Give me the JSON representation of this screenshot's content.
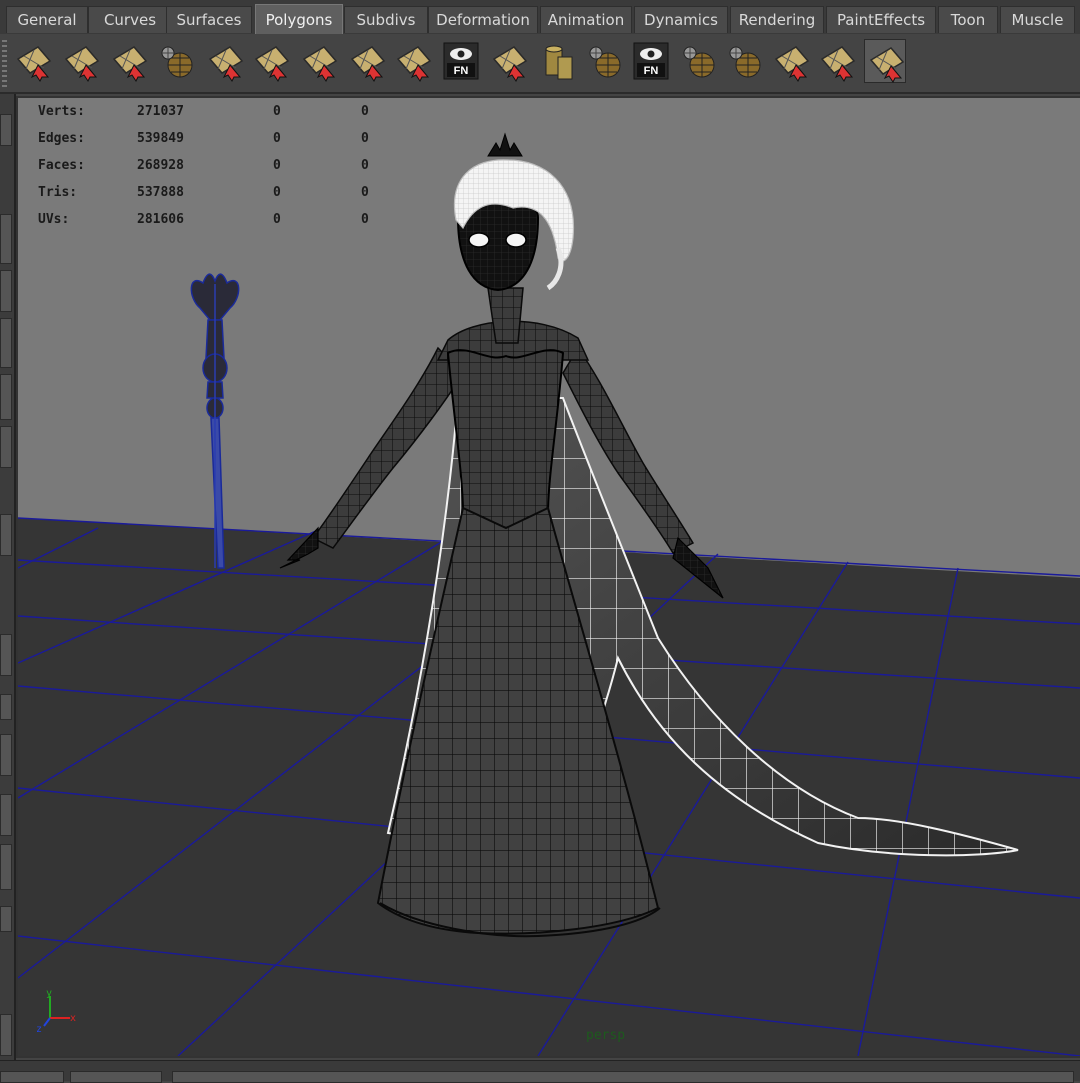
{
  "menu_tabs": [
    {
      "label": "General",
      "active": false
    },
    {
      "label": "Curves",
      "active": false
    },
    {
      "label": "Surfaces",
      "active": false
    },
    {
      "label": "Polygons",
      "active": true
    },
    {
      "label": "Subdivs",
      "active": false
    },
    {
      "label": "Deformation",
      "active": false
    },
    {
      "label": "Animation",
      "active": false
    },
    {
      "label": "Dynamics",
      "active": false
    },
    {
      "label": "Rendering",
      "active": false
    },
    {
      "label": "PaintEffects",
      "active": false
    },
    {
      "label": "Toon",
      "active": false
    },
    {
      "label": "Muscle",
      "active": false
    }
  ],
  "shelf_icons": [
    {
      "icon": "select-face-icon",
      "label": ""
    },
    {
      "icon": "edit-vertex-icon",
      "label": ""
    },
    {
      "icon": "extrude-icon",
      "label": ""
    },
    {
      "icon": "sphere-grid-icon",
      "label": ""
    },
    {
      "icon": "select-face-arrow-icon",
      "label": ""
    },
    {
      "icon": "uv-striped-icon",
      "label": ""
    },
    {
      "icon": "split-polygon-icon",
      "label": ""
    },
    {
      "icon": "planar-map-icon",
      "label": ""
    },
    {
      "icon": "uv-layout-icon",
      "label": ""
    },
    {
      "icon": "eye-fn-icon",
      "label": "FN"
    },
    {
      "icon": "cut-faces-icon",
      "label": ""
    },
    {
      "icon": "cylinder-icon",
      "label": ""
    },
    {
      "icon": "sphere-cube-icon",
      "label": ""
    },
    {
      "icon": "eye-fn-icon",
      "label": "FN"
    },
    {
      "icon": "globe-sphere-icon",
      "label": ""
    },
    {
      "icon": "shield-sphere-icon",
      "label": ""
    },
    {
      "icon": "pin-plane-icon",
      "label": ""
    },
    {
      "icon": "pencil-plane-icon",
      "label": ""
    },
    {
      "icon": "select-face-icon",
      "label": ""
    }
  ],
  "hud": {
    "rows": [
      {
        "label": "Verts:",
        "value": "271037",
        "sel": "0",
        "extra": "0"
      },
      {
        "label": "Edges:",
        "value": "539849",
        "sel": "0",
        "extra": "0"
      },
      {
        "label": "Faces:",
        "value": "268928",
        "sel": "0",
        "extra": "0"
      },
      {
        "label": "Tris:",
        "value": "537888",
        "sel": "0",
        "extra": "0"
      },
      {
        "label": "UVs:",
        "value": "281606",
        "sel": "0",
        "extra": "0"
      }
    ]
  },
  "camera_label": "persp",
  "axis_labels": {
    "x": "x",
    "y": "y",
    "z": "z"
  },
  "colors": {
    "viewport_bg": "#7a7a7a",
    "floor": "#353535",
    "grid_line": "#1a1a9a",
    "mesh_fill": "#3c3c3c",
    "wire": "#0c0c0c",
    "highlight_wire": "#f2f2f2",
    "staff": "#2a3cb0"
  }
}
